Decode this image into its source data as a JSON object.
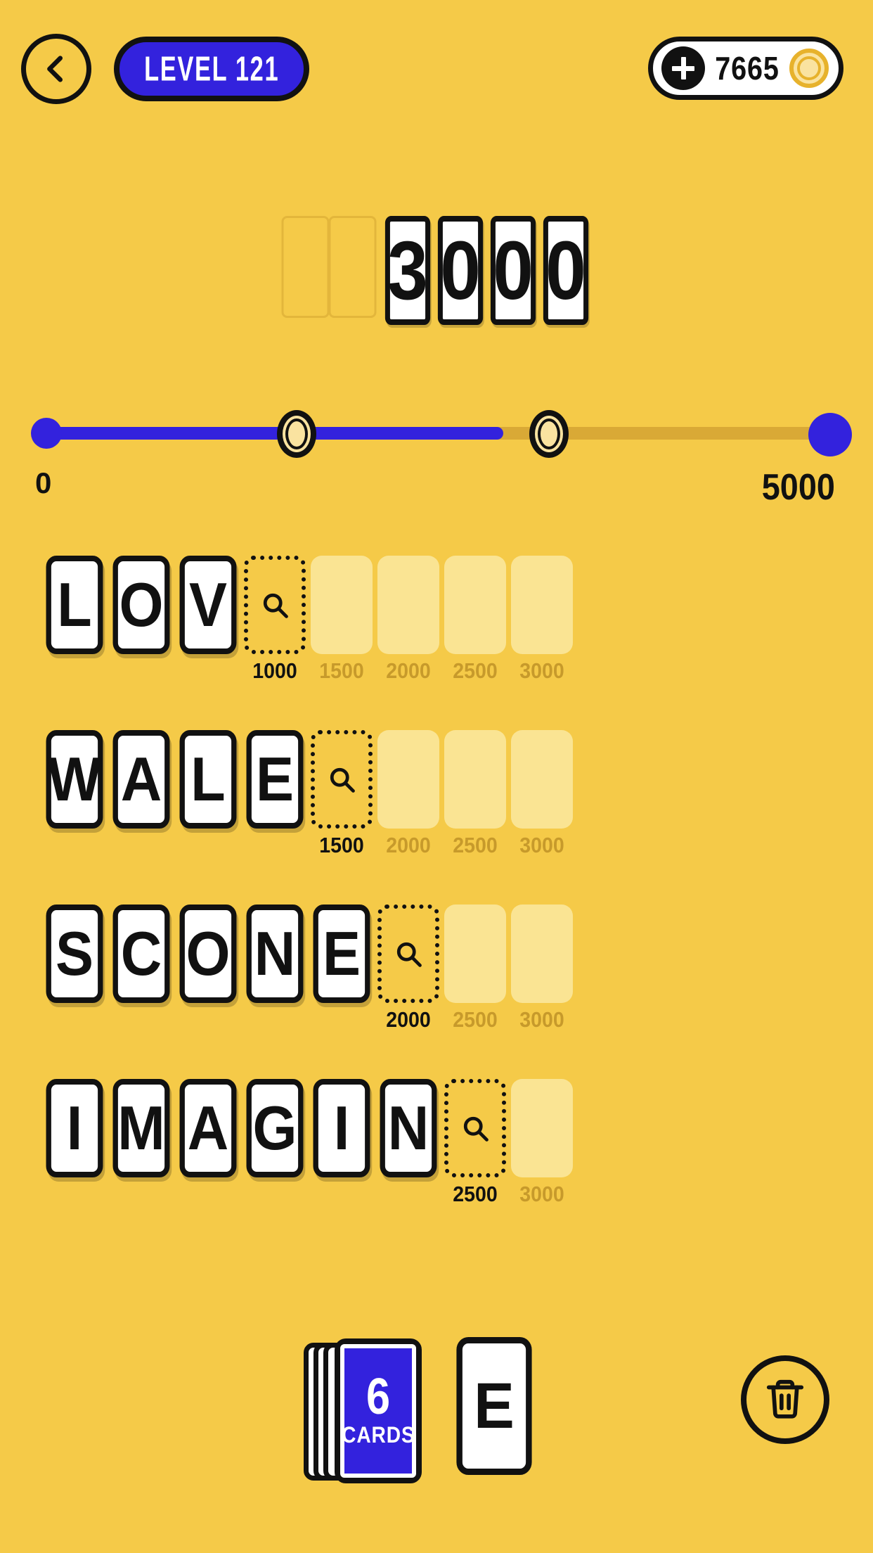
{
  "header": {
    "back_icon": "chevron-left-icon",
    "level_label": "LEVEL 121",
    "plus_icon": "plus-icon",
    "coin_balance": "7665",
    "coin_icon": "coin-icon"
  },
  "score": {
    "empty_slots": 2,
    "digits": [
      "3",
      "0",
      "0",
      "0"
    ],
    "value": "3000"
  },
  "slider": {
    "min_label": "0",
    "max_label": "5000",
    "min_value": 0,
    "max_value": 5000,
    "current_value": 3000,
    "fill_percent": 58.5,
    "markers": [
      {
        "icon": "coin-icon",
        "position_percent": 33
      },
      {
        "icon": "coin-icon",
        "position_percent": 65
      }
    ],
    "track_color": "#D9A936",
    "fill_color": "#3322DD"
  },
  "board": {
    "hint_icon": "magnifier-icon",
    "rows": [
      {
        "letters": [
          "L",
          "O",
          "V"
        ],
        "hint_cost": "1000",
        "locked_costs": [
          "1500",
          "2000",
          "2500",
          "3000"
        ]
      },
      {
        "letters": [
          "W",
          "A",
          "L",
          "E"
        ],
        "hint_cost": "1500",
        "locked_costs": [
          "2000",
          "2500",
          "3000"
        ]
      },
      {
        "letters": [
          "S",
          "C",
          "O",
          "N",
          "E"
        ],
        "hint_cost": "2000",
        "locked_costs": [
          "2500",
          "3000"
        ]
      },
      {
        "letters": [
          "I",
          "M",
          "A",
          "G",
          "I",
          "N"
        ],
        "hint_cost": "2500",
        "locked_costs": [
          "3000"
        ]
      }
    ]
  },
  "footer": {
    "deck_count": "6",
    "deck_label": "CARDS",
    "next_letter": "E",
    "trash_icon": "trash-icon"
  },
  "colors": {
    "background": "#F5CA48",
    "accent_blue": "#3322DD",
    "tile_white": "#FFFFFF",
    "ink": "#111111",
    "empty_slot": "#FAE493",
    "dim_label": "#C79A2B"
  }
}
